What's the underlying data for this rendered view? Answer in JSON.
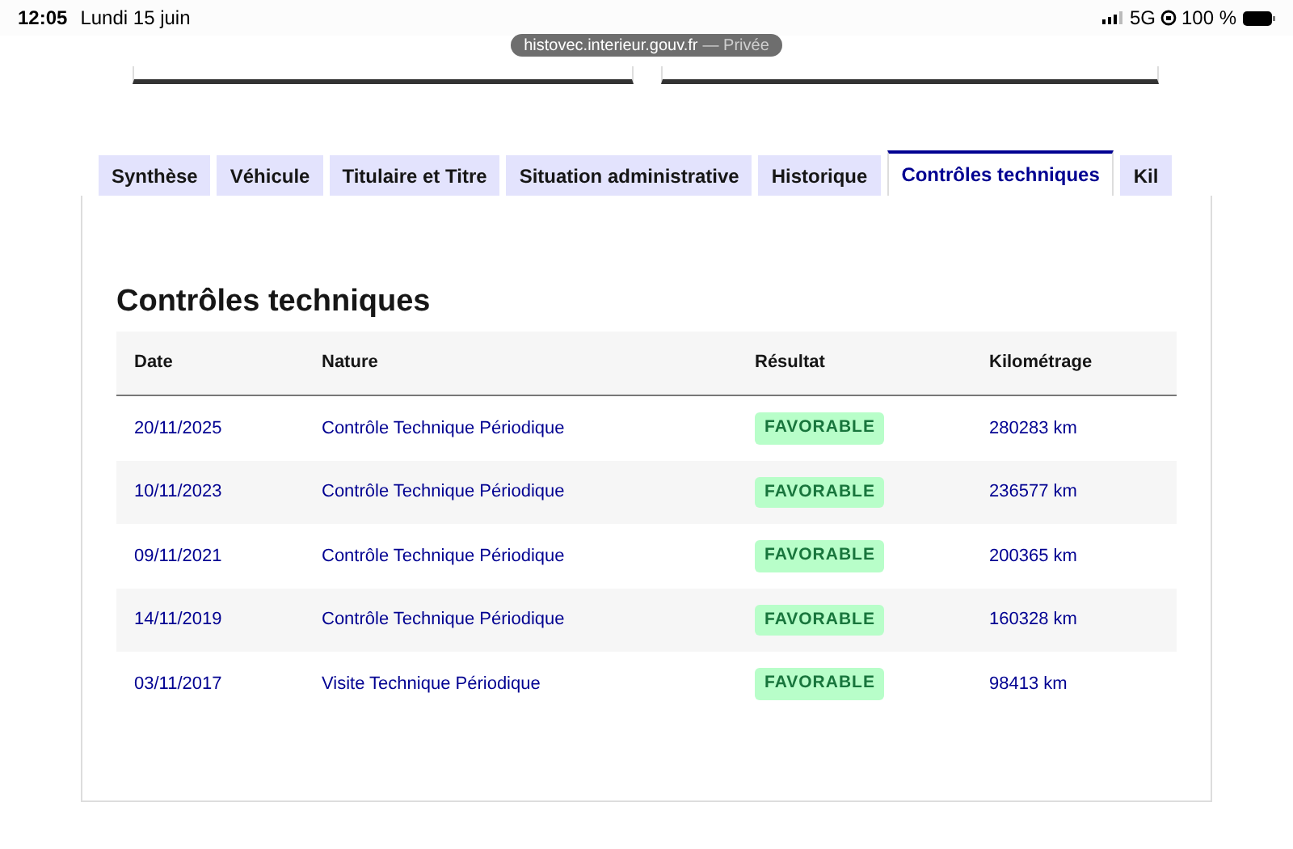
{
  "status_bar": {
    "time": "12:05",
    "date": "Lundi 15 juin",
    "network": "5G",
    "battery": "100 %"
  },
  "url_bar": {
    "domain": "histovec.interieur.gouv.fr",
    "mode": "— Privée"
  },
  "tabs": [
    {
      "label": "Synthèse",
      "selected": false
    },
    {
      "label": "Véhicule",
      "selected": false
    },
    {
      "label": "Titulaire et Titre",
      "selected": false
    },
    {
      "label": "Situation administrative",
      "selected": false
    },
    {
      "label": "Historique",
      "selected": false
    },
    {
      "label": "Contrôles techniques",
      "selected": true
    },
    {
      "label": "Kil",
      "selected": false
    }
  ],
  "section": {
    "title": "Contrôles techniques",
    "table": {
      "columns": [
        "Date",
        "Nature",
        "Résultat",
        "Kilométrage"
      ],
      "rows": [
        {
          "date": "20/11/2025",
          "nature": "Contrôle Technique Périodique",
          "result": "FAVORABLE",
          "mileage": "280283 km"
        },
        {
          "date": "10/11/2023",
          "nature": "Contrôle Technique Périodique",
          "result": "FAVORABLE",
          "mileage": "236577 km"
        },
        {
          "date": "09/11/2021",
          "nature": "Contrôle Technique Périodique",
          "result": "FAVORABLE",
          "mileage": "200365 km"
        },
        {
          "date": "14/11/2019",
          "nature": "Contrôle Technique Périodique",
          "result": "FAVORABLE",
          "mileage": "160328 km"
        },
        {
          "date": "03/11/2017",
          "nature": "Visite Technique Périodique",
          "result": "FAVORABLE",
          "mileage": "98413 km"
        }
      ]
    }
  }
}
